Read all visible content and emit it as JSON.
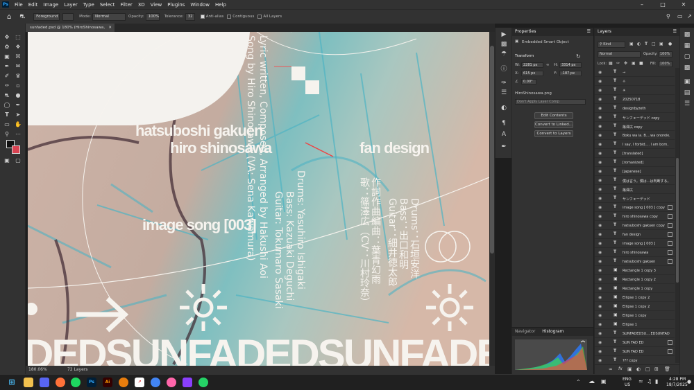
{
  "menubar": {
    "app_icon": "Ps",
    "items": [
      "File",
      "Edit",
      "Image",
      "Layer",
      "Type",
      "Select",
      "Filter",
      "3D",
      "View",
      "Plugins",
      "Window",
      "Help"
    ]
  },
  "options": {
    "sample": "Foreground",
    "mode_label": "Mode:",
    "mode": "Normal",
    "opacity_label": "Opacity:",
    "opacity": "100%",
    "tolerance_label": "Tolerance:",
    "tolerance": "32",
    "anti_alias": "Anti-alias",
    "contiguous": "Contiguous",
    "all_layers": "All Layers"
  },
  "document": {
    "tab_title": "sunfaded.psd @ 180% (HiroShinosawa, RGB/8#) *",
    "zoom": "180.06%",
    "layers_count": "72 Layers"
  },
  "artwork": {
    "line1": "hatsuboshi gakuen",
    "line2": "hiro shinosawa",
    "line3": "fan design",
    "line4": "image song [003]",
    "vertical1": "Song by Hiro Shinosawa (VA: Sena Kawamura)",
    "vertical2": "Lyric written, Composed, Arranged by Hakushi Aoi",
    "vertical3": "Guitar: Tokumaro Sasaki",
    "vertical4": "Bass: Kazuaki Deguchi",
    "vertical5": "Drums: Yasuhiro Ishigaki",
    "vertical_jp1": "歌：篠澤広（CV：川村玲奈）",
    "vertical_jp2": "作詞作曲編曲：葉青幻雨",
    "vertical_jp3": "Guitar：細井徳太郎",
    "vertical_jp4": "Bass：出口和明",
    "vertical_jp5": "Drums：石垣安洋",
    "bottom_text": "DEDSUNFADEDSUNFADEDSUNFADEDSUNFADED"
  },
  "properties": {
    "tab": "Properties",
    "type": "Embedded Smart Object",
    "transform": "Transform",
    "w_label": "W:",
    "w": "2281 px",
    "h_label": "H:",
    "h": "3314 px",
    "x_label": "X:",
    "x": "615 px",
    "y_label": "Y:",
    "y": "-187 px",
    "angle": "0.00°",
    "file": "HiroShinosawa.png",
    "layer_comp": "Don't Apply Layer Comp",
    "btn_edit": "Edit Contents",
    "btn_linked": "Convert to Linked...",
    "btn_layers": "Convert to Layers"
  },
  "navigator": {
    "tab1": "Navigator",
    "tab2": "Histogram"
  },
  "layers_panel": {
    "tab": "Layers",
    "kind": "Kind",
    "blend": "Normal",
    "opacity_label": "Opacity:",
    "opacity": "100%",
    "lock_label": "Lock:",
    "fill_label": "Fill:",
    "fill": "100%",
    "items": [
      {
        "type": "T",
        "name": "→",
        "fx": false
      },
      {
        "type": "T",
        "name": "☼",
        "fx": false
      },
      {
        "type": "T",
        "name": "☀",
        "fx": false
      },
      {
        "type": "T",
        "name": "20250718",
        "fx": false
      },
      {
        "type": "T",
        "name": "designbyzeth",
        "fx": false
      },
      {
        "type": "T",
        "name": "サンフェーデッド copy",
        "fx": false
      },
      {
        "type": "T",
        "name": "篠澤広 copy",
        "fx": false
      },
      {
        "type": "T",
        "name": "Boku wa ia. B....wa onoroku. B",
        "fx": false
      },
      {
        "type": "T",
        "name": "I say, I forbid.... I am born, I f",
        "fx": false
      },
      {
        "type": "T",
        "name": "[translated]",
        "fx": false
      },
      {
        "type": "T",
        "name": "[romanized]",
        "fx": false
      },
      {
        "type": "T",
        "name": "[japanese]",
        "fx": false
      },
      {
        "type": "T",
        "name": "僕は言う。僕は...は判断する。",
        "fx": false
      },
      {
        "type": "T",
        "name": "篠澤広",
        "fx": false
      },
      {
        "type": "T",
        "name": "サンフェーデッド",
        "fx": false
      },
      {
        "type": "T",
        "name": "image song [ 003 ] copy",
        "fx": true
      },
      {
        "type": "T",
        "name": "hiro shinosawa copy",
        "fx": true
      },
      {
        "type": "T",
        "name": "hatsuboshi gakuen copy",
        "fx": true
      },
      {
        "type": "T",
        "name": "fan design",
        "fx": true
      },
      {
        "type": "T",
        "name": "image song [ 003 ]",
        "fx": true
      },
      {
        "type": "T",
        "name": "hiro shinosawa",
        "fx": true
      },
      {
        "type": "T",
        "name": "hatsuboshi gakuen",
        "fx": true
      },
      {
        "type": "S",
        "name": "Rectangle 1 copy 3",
        "fx": false
      },
      {
        "type": "S",
        "name": "Rectangle 1 copy 2",
        "fx": false
      },
      {
        "type": "S",
        "name": "Rectangle 1 copy",
        "fx": false
      },
      {
        "type": "S",
        "name": "Ellipse 1 copy 2",
        "fx": false
      },
      {
        "type": "S",
        "name": "Ellipse 1 copy 2",
        "fx": false
      },
      {
        "type": "S",
        "name": "Ellipse 1 copy",
        "fx": false
      },
      {
        "type": "S",
        "name": "Ellipse 1",
        "fx": false
      },
      {
        "type": "T",
        "name": "SUNFADEDSU....EDSUNFADED",
        "fx": false
      },
      {
        "type": "T",
        "name": "SUN FAD ED",
        "fx": true
      },
      {
        "type": "T",
        "name": "SUN FAD ED",
        "fx": true
      },
      {
        "type": "T",
        "name": "??? copy",
        "fx": false
      }
    ]
  },
  "taskbar": {
    "lang": "ENG",
    "region": "US",
    "time": "4:28 PM",
    "date": "18/7/2025"
  }
}
